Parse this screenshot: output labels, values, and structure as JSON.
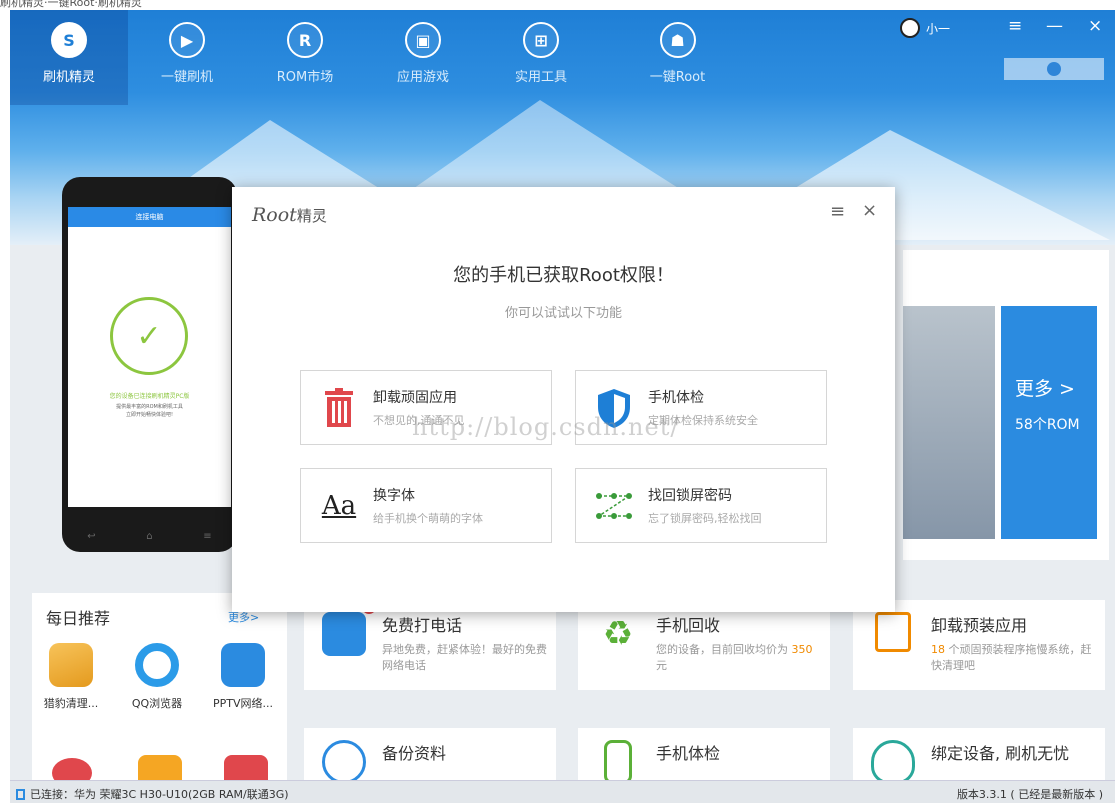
{
  "top_caption": "刷机精灵·一键Root·刷机精灵",
  "nav": [
    {
      "label": "刷机精灵",
      "icon": "shield-icon",
      "glyph": "S"
    },
    {
      "label": "一键刷机",
      "icon": "play-icon",
      "glyph": "▶"
    },
    {
      "label": "ROM市场",
      "icon": "rom-icon",
      "glyph": "R"
    },
    {
      "label": "应用游戏",
      "icon": "app-game-icon",
      "glyph": "▣"
    },
    {
      "label": "实用工具",
      "icon": "tools-icon",
      "glyph": "⊞"
    },
    {
      "label": "一键Root",
      "icon": "android-icon",
      "glyph": "☗"
    }
  ],
  "user": {
    "name": "小一"
  },
  "window_controls": {
    "menu": "≡",
    "minimize": "—",
    "close": "×"
  },
  "phone": {
    "title": "连接电脑",
    "status_msg": "您的设备已连接刷机精灵PC版",
    "sub_msg_1": "提供最丰富的ROM和刷机工具",
    "sub_msg_2": "立即开始畅快体验吧!"
  },
  "rom_card": {
    "more": "更多 >",
    "count": "58个ROM"
  },
  "dialog": {
    "logo_script": "Root",
    "logo_text": "精灵",
    "title": "您的手机已获取Root权限！",
    "subtitle": "你可以试试以下功能",
    "watermark": "http://blog.csdn.net/",
    "features": [
      {
        "title": "卸载顽固应用",
        "desc": "不想见的,通通不见"
      },
      {
        "title": "手机体检",
        "desc": "定期体检保持系统安全"
      },
      {
        "title": "换字体",
        "desc": "给手机换个萌萌的字体",
        "glyph": "Aa"
      },
      {
        "title": "找回锁屏密码",
        "desc": "忘了锁屏密码,轻松找回"
      }
    ]
  },
  "daily": {
    "title": "每日推荐",
    "more": "更多>",
    "apps": [
      {
        "label": "猎豹清理..."
      },
      {
        "label": "QQ浏览器"
      },
      {
        "label": "PPTV网络..."
      }
    ]
  },
  "cards": [
    {
      "title": "免费打电话",
      "desc": "异地免费，赶紧体验！最好的免费网络电话"
    },
    {
      "title": "手机回收",
      "desc_prefix": "您的设备，目前回收均价为 ",
      "price": "350",
      "desc_suffix": " 元"
    },
    {
      "title": "卸载预装应用",
      "count": "18",
      "desc": " 个顽固预装程序拖慢系统，赶快清理吧"
    },
    {
      "title": "备份资料"
    },
    {
      "title": "手机体检"
    },
    {
      "title": "绑定设备, 刷机无忧"
    }
  ],
  "status": {
    "connected": "已连接：华为 荣耀3C H30-U10(2GB RAM/联通3G)",
    "version": "版本3.3.1 ( 已经是最新版本 )"
  },
  "colors": {
    "brand_blue": "#1f7fd6",
    "accent_green": "#8cc63f",
    "accent_orange": "#f08a00",
    "red": "#e0474c"
  }
}
